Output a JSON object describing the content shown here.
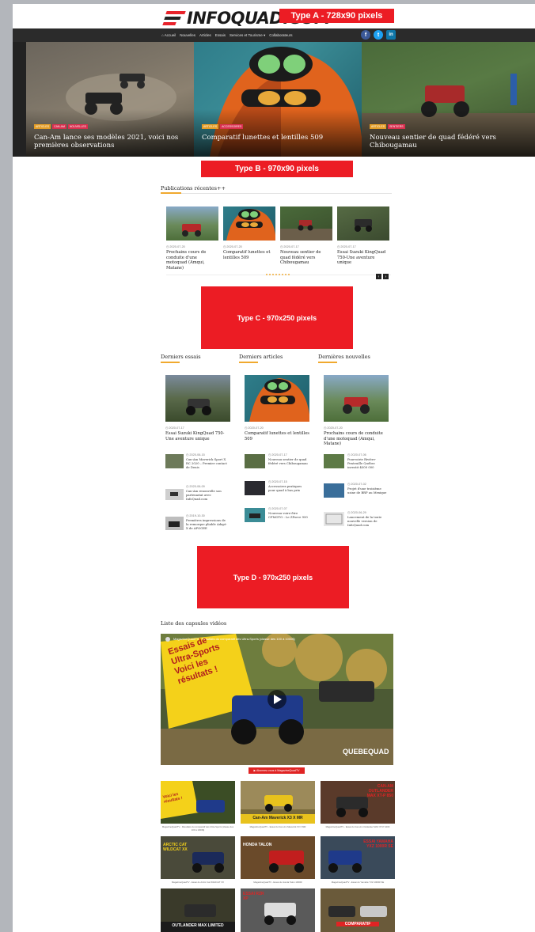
{
  "header": {
    "logo_text": "INFOQUAD.COM",
    "ad_a": "Type A - 728x90 pixels"
  },
  "nav": {
    "items": [
      "⌂ Accueil",
      "Nouvelles",
      "Articles",
      "Essais",
      "Services et Tourisme",
      "Collaborateurs"
    ],
    "socials": [
      {
        "icon": "facebook-icon",
        "glyph": "f",
        "color": "#3b5998"
      },
      {
        "icon": "twitter-icon",
        "glyph": "t",
        "color": "#1da1f2"
      },
      {
        "icon": "linkedin-icon",
        "glyph": "in",
        "color": "#0e76a8"
      }
    ]
  },
  "hero": {
    "slides": [
      {
        "title": "Can-Am lance ses modèles 2021, voici nos premières observations",
        "tags": [
          "ARTICLES",
          "CAN-AM",
          "NOUVELLES"
        ]
      },
      {
        "title": "Comparatif lunettes et lentilles 509",
        "tags": [
          "ARTICLES",
          "ACCESSOIRES"
        ]
      },
      {
        "title": "Nouveau sentier de quad fédéré vers Chibougamau",
        "tags": [
          "ARTICLES",
          "SENTIERS"
        ]
      }
    ]
  },
  "ads": {
    "b": "Type B - 970x90 pixels",
    "c": "Type C - 970x250 pixels",
    "d": "Type D - 970x250 pixels"
  },
  "recent": {
    "title": "Publications récentes++",
    "items": [
      {
        "date": "2020-07-20",
        "title": "Prochains cours de conduite d'une motoquad (Amqui, Matane)"
      },
      {
        "date": "2020-07-20",
        "title": "Comparatif lunettes et lentilles 509"
      },
      {
        "date": "2020-07-17",
        "title": "Nouveau sentier de quad fédéré vers Chibougamau"
      },
      {
        "date": "2020-07-17",
        "title": "Essai Suzuki KingQuad 750-Une aventure unique"
      }
    ],
    "prev": "‹",
    "next": "›"
  },
  "columns": [
    {
      "title": "Derniers essais",
      "feature": {
        "date": "2020-07-17",
        "title": "Essai Suzuki KingQuad 750-Une aventure unique"
      },
      "list": [
        {
          "date": "2020-06-15",
          "title": "Can-Am Maverick Sport X RC 2020 – Premier contact de Denis"
        },
        {
          "date": "2020-06-09",
          "title": "Can-Am renouvelle son partenariat avec InfoQuad.com"
        },
        {
          "date": "2019-10-30",
          "title": "Premières impressions de la remorque pliable Adapt-X de APOGEE"
        }
      ]
    },
    {
      "title": "Derniers articles",
      "feature": {
        "date": "2020-07-20",
        "title": "Comparatif lunettes et lentilles 509"
      },
      "list": [
        {
          "date": "2020-07-17",
          "title": "Nouveau sentier de quad fédéré vers Chibougamau"
        },
        {
          "date": "2020-07-15",
          "title": "Accessoires pratiques pour quad à bas prix"
        },
        {
          "date": "2020-07-07",
          "title": "Nouveau voire-être CFMOTO : Le ZForce 950"
        }
      ]
    },
    {
      "title": "Dernières nouvelles",
      "feature": {
        "date": "2020-07-20",
        "title": "Prochains cours de conduite d'une motoquad (Amqui, Matane)"
      },
      "list": [
        {
          "date": "2020-07-06",
          "title": "Pourvoirie Rivière-Penteuille Québec investit $500 000"
        },
        {
          "date": "2020-07-02",
          "title": "Projet d'une troisième usine de BRP au Mexique"
        },
        {
          "date": "2020-06-29",
          "title": "Lancement de la toute nouvelle version de InfoQuad.com"
        }
      ]
    }
  ],
  "videos": {
    "title": "Liste des capsules vidéos",
    "main_title": "MagazineQuadTV - Résultats du comparatif des Ultra-Sports (classe des 100 à 1000$)",
    "main_overlay": "Essais de Ultra-Sports Voici les résultats !",
    "brand": "QUEBEQUAD",
    "subscribe": "▶ Abonnez-vous à MagazineQuadTV",
    "thumbs": [
      {
        "caption": "MagazineQuadTV - Résultats du comparatif des Ultra-Sports (classe des 100 à 1000$)",
        "label": "Voici les résultats !",
        "color": "#3b4d25"
      },
      {
        "caption": "MagazineQuadTV - Essai du Can-Am Maverick X3 X MR",
        "label": "Can-Am Maverick X3 X MR",
        "color": "#7a6a3a"
      },
      {
        "caption": "MagazineQuadTV - Essai du Can-Am Outlander MAX XT-P 1000",
        "label": "CAN-AM OUTLANDER MAX XT-P 850",
        "color": "#5a3a2a"
      },
      {
        "caption": "MagazineQuadTV - Essai du Arctic Cat WILDCAT XX",
        "label": "ARCTIC CAT WILDCAT XX",
        "color": "#4a4a3a"
      },
      {
        "caption": "MagazineQuadTV - Essai du Honda Talon 1000R",
        "label": "HONDA TALON",
        "color": "#6a4a2a"
      },
      {
        "caption": "MagazineQuadTV - Essai du Yamaha YXZ 1000R SE",
        "label": "ESSAI YAMAHA YXZ 1000R SE",
        "color": "#3a4a5a"
      },
      {
        "caption": "MagazineQuadTV - Essai du Can-Am Outlander MAX Limited",
        "label": "OUTLANDER MAX LIMITED",
        "color": "#3a3a2a"
      },
      {
        "caption": "MagazineQuadTV - Essai du Polaris RZR XP",
        "label": "ESSAI RZR XP",
        "color": "#5a5a5a"
      },
      {
        "caption": "MagazineQuadTV - Comparatif Maverick Trail vs Maverick Sport",
        "label": "COMPARATIF",
        "color": "#6a5a3a"
      }
    ]
  }
}
